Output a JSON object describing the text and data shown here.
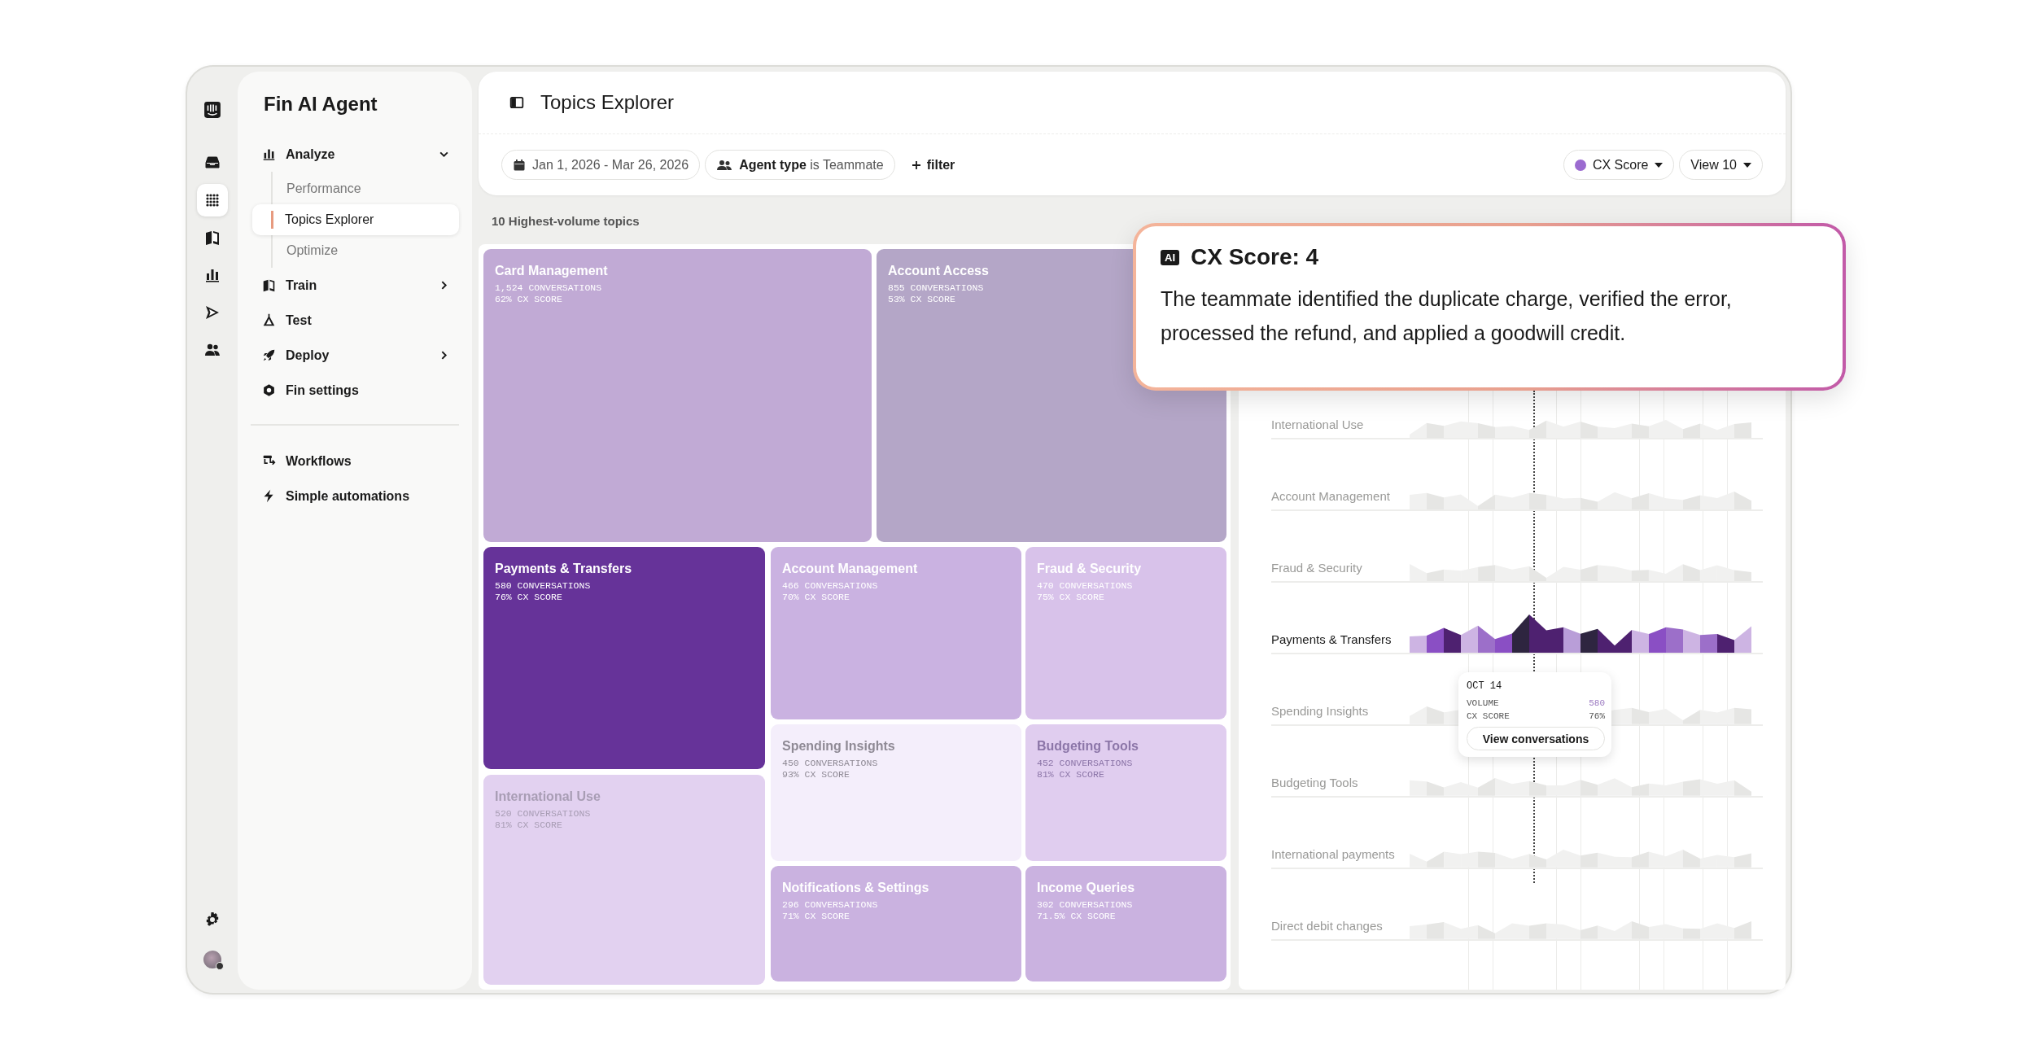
{
  "rail": {
    "items": [
      {
        "selected": false
      },
      {
        "selected": true
      },
      {
        "selected": false
      },
      {
        "selected": false
      },
      {
        "selected": false
      },
      {
        "selected": false
      }
    ]
  },
  "sidebar": {
    "title": "Fin AI Agent",
    "sections": [
      [
        {
          "label": "Analyze",
          "expanded": true,
          "children": [
            {
              "label": "Performance",
              "selected": false
            },
            {
              "label": "Topics Explorer",
              "selected": true
            },
            {
              "label": "Optimize",
              "selected": false
            }
          ]
        },
        {
          "label": "Train",
          "expanded": false
        },
        {
          "label": "Test"
        },
        {
          "label": "Deploy",
          "expanded": false
        },
        {
          "label": "Fin settings"
        }
      ],
      [
        {
          "label": "Workflows"
        },
        {
          "label": "Simple automations"
        }
      ]
    ]
  },
  "header": {
    "title": "Topics Explorer"
  },
  "filters": {
    "date": "Jan 1, 2026 - Mar 26, 2026",
    "agent": "**Agent type** is Teammate",
    "add": "filter"
  },
  "controls": {
    "metric": {
      "label": "CX Score",
      "color": "#9b6bd0"
    },
    "view": "View 10"
  },
  "section_title": "10 Highest-volume topics",
  "treemap": {
    "tiles": [
      {
        "name": "Card Management",
        "stats": [
          "1,524 CONVERSATIONS",
          "62% CX SCORE"
        ],
        "color": "#c1aad5",
        "kind": "light"
      },
      {
        "name": "Account Access",
        "stats": [
          "855 CONVERSATIONS",
          "53% CX SCORE"
        ],
        "color": "#b4a6c7",
        "kind": "light"
      },
      {
        "name": "Payments & Transfers",
        "stats": [
          "580 CONVERSATIONS",
          "76% CX SCORE"
        ],
        "color": "#663399",
        "kind": "light"
      },
      {
        "name": "International Use",
        "stats": [
          "520 CONVERSATIONS",
          "81% CX SCORE"
        ],
        "color": "#e2d1f0",
        "kind": "muted"
      },
      {
        "name": "Account Management",
        "stats": [
          "466 CONVERSATIONS",
          "70% CX SCORE"
        ],
        "color": "#cab2e1",
        "kind": "light"
      },
      {
        "name": "Fraud & Security",
        "stats": [
          "470 CONVERSATIONS",
          "75% CX SCORE"
        ],
        "color": "#d8c2ea",
        "kind": "light"
      },
      {
        "name": "Spending Insights",
        "stats": [
          "450 CONVERSATIONS",
          "93% CX SCORE"
        ],
        "color": "#f4eefb",
        "kind": "muted"
      },
      {
        "name": "Budgeting Tools",
        "stats": [
          "452 CONVERSATIONS",
          "81% CX SCORE"
        ],
        "color": "#e0cdef",
        "kind": "pale"
      },
      {
        "name": "Notifications & Settings",
        "stats": [
          "296 CONVERSATIONS",
          "71% CX SCORE"
        ],
        "color": "#cab2e0",
        "kind": "light"
      },
      {
        "name": "Income Queries",
        "stats": [
          "302 CONVERSATIONS",
          "71.5% CX SCORE"
        ],
        "color": "#cab2e0",
        "kind": "light"
      }
    ]
  },
  "trends": {
    "rows": [
      {
        "label": "International Use",
        "selected": false
      },
      {
        "label": "Account Management",
        "selected": false
      },
      {
        "label": "Fraud & Security",
        "selected": false
      },
      {
        "label": "Payments & Transfers",
        "selected": true
      },
      {
        "label": "Spending Insights",
        "selected": false
      },
      {
        "label": "Budgeting Tools",
        "selected": false
      },
      {
        "label": "International payments",
        "selected": false
      },
      {
        "label": "Direct debit changes",
        "selected": false
      }
    ],
    "tooltip": {
      "date": "OCT 14",
      "metrics": [
        {
          "label": "VOLUME",
          "value": "580"
        },
        {
          "label": "CX SCORE",
          "value": "76%"
        }
      ],
      "button": "View conversations"
    }
  },
  "callout": {
    "badge": "AI",
    "title": "CX Score: 4",
    "text": "The teammate identified the duplicate charge, verified the error, processed the refund, and applied a goodwill credit."
  }
}
